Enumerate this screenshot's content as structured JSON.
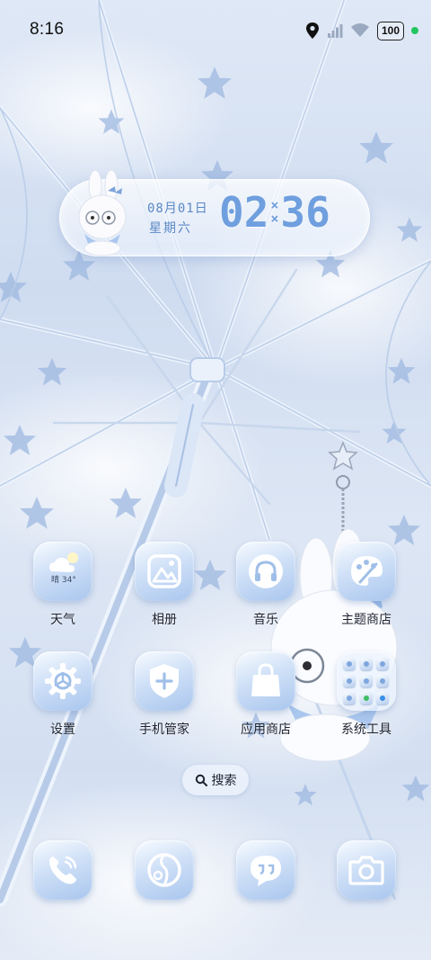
{
  "status_bar": {
    "time": "8:16",
    "battery": "100",
    "icons": [
      "location-pin-icon",
      "cellular-signal-icon",
      "wifi-icon",
      "battery-icon"
    ],
    "indicator_color": "#22c55e"
  },
  "clock_widget": {
    "date": "08月01日",
    "weekday": "星期六",
    "hour": "02",
    "minute": "36",
    "separator": "×"
  },
  "apps": {
    "row1": [
      {
        "label": "天气",
        "icon": "weather-icon",
        "weather_text": "晴 34°"
      },
      {
        "label": "相册",
        "icon": "gallery-icon"
      },
      {
        "label": "音乐",
        "icon": "headphones-icon"
      },
      {
        "label": "主题商店",
        "icon": "palette-icon"
      }
    ],
    "row2": [
      {
        "label": "设置",
        "icon": "gear-icon"
      },
      {
        "label": "手机管家",
        "icon": "shield-plus-icon"
      },
      {
        "label": "应用商店",
        "icon": "shopping-bag-icon"
      },
      {
        "label": "系统工具",
        "icon": "folder-icon"
      }
    ]
  },
  "search": {
    "label": "搜索",
    "icon": "search-icon"
  },
  "dock": [
    {
      "icon": "phone-icon"
    },
    {
      "icon": "browser-icon"
    },
    {
      "icon": "messages-icon"
    },
    {
      "icon": "camera-icon"
    }
  ],
  "theme": {
    "accent": "#6f9fde",
    "icon_gradient_top": "#f7fbff",
    "icon_gradient_bottom": "#a9c6ee"
  }
}
